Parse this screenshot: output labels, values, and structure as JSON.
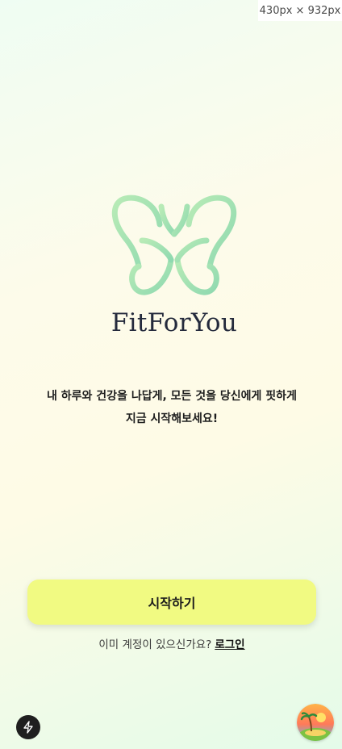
{
  "viewport": {
    "size_label": "430px × 932px"
  },
  "brand": {
    "name": "FitForYou",
    "logo_icon": "butterfly-logo-icon",
    "logo_color": "#a6e3b0"
  },
  "intro": {
    "line1": "내 하루와 건강을 나답게, 모든 것을 당신에게 핏하게",
    "line2": "지금 시작해보세요!"
  },
  "actions": {
    "start_label": "시작하기",
    "start_color": "#f1fa82",
    "login_prompt": "이미 계정이 있으신가요?",
    "login_link": "로그인"
  },
  "floating": {
    "left_icon": "lightning-bolt-icon",
    "right_icon": "beach-avatar-icon"
  }
}
